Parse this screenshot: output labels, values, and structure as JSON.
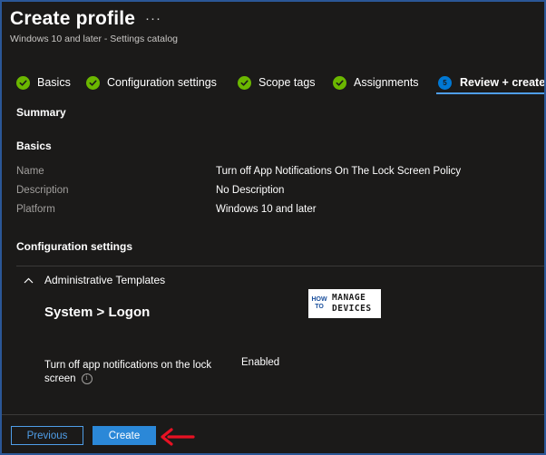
{
  "header": {
    "title": "Create profile",
    "more": "···",
    "subtitle": "Windows 10 and later - Settings catalog"
  },
  "tabs": [
    {
      "label": "Basics",
      "state": "complete"
    },
    {
      "label": "Configuration settings",
      "state": "complete"
    },
    {
      "label": "Scope tags",
      "state": "complete"
    },
    {
      "label": "Assignments",
      "state": "complete"
    },
    {
      "label": "Review + create",
      "state": "active",
      "step": "5"
    }
  ],
  "summary": {
    "heading": "Summary",
    "basics_heading": "Basics",
    "fields": [
      {
        "label": "Name",
        "value": "Turn off App Notifications On The Lock Screen Policy"
      },
      {
        "label": "Description",
        "value": "No Description"
      },
      {
        "label": "Platform",
        "value": "Windows 10 and later"
      }
    ],
    "config_heading": "Configuration settings",
    "group_label": "Administrative Templates",
    "category": "System > Logon",
    "setting": {
      "name": "Turn off app notifications on the lock screen",
      "value": "Enabled"
    }
  },
  "logo": {
    "how": "HOW",
    "to": "TO",
    "manage": "MANAGE",
    "devices": "DEVICES"
  },
  "footer": {
    "previous_label": "Previous",
    "create_label": "Create"
  },
  "colors": {
    "background": "#1b1a19",
    "accent": "#0078d4",
    "success": "#6bb700",
    "annotation_arrow": "#e81123"
  }
}
